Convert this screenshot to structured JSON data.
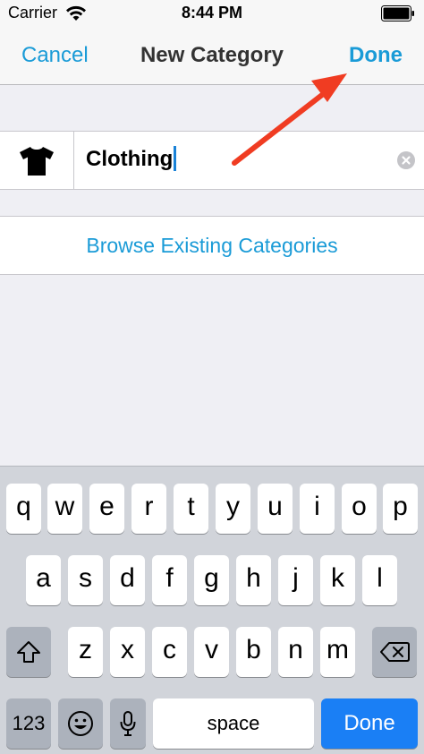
{
  "status": {
    "carrier": "Carrier",
    "time": "8:44 PM"
  },
  "nav": {
    "cancel": "Cancel",
    "title": "New Category",
    "done": "Done"
  },
  "category": {
    "icon": "tshirt-icon",
    "name": "Clothing"
  },
  "browse": {
    "label": "Browse Existing Categories"
  },
  "annotation": {
    "color": "#f03c22"
  },
  "keyboard": {
    "row1": [
      "q",
      "w",
      "e",
      "r",
      "t",
      "y",
      "u",
      "i",
      "o",
      "p"
    ],
    "row2": [
      "a",
      "s",
      "d",
      "f",
      "g",
      "h",
      "j",
      "k",
      "l"
    ],
    "row3": [
      "z",
      "x",
      "c",
      "v",
      "b",
      "n",
      "m"
    ],
    "numbers": "123",
    "space": "space",
    "done": "Done"
  },
  "colors": {
    "accent": "#1a9bd7",
    "keyboard_done": "#1a7ff5"
  }
}
